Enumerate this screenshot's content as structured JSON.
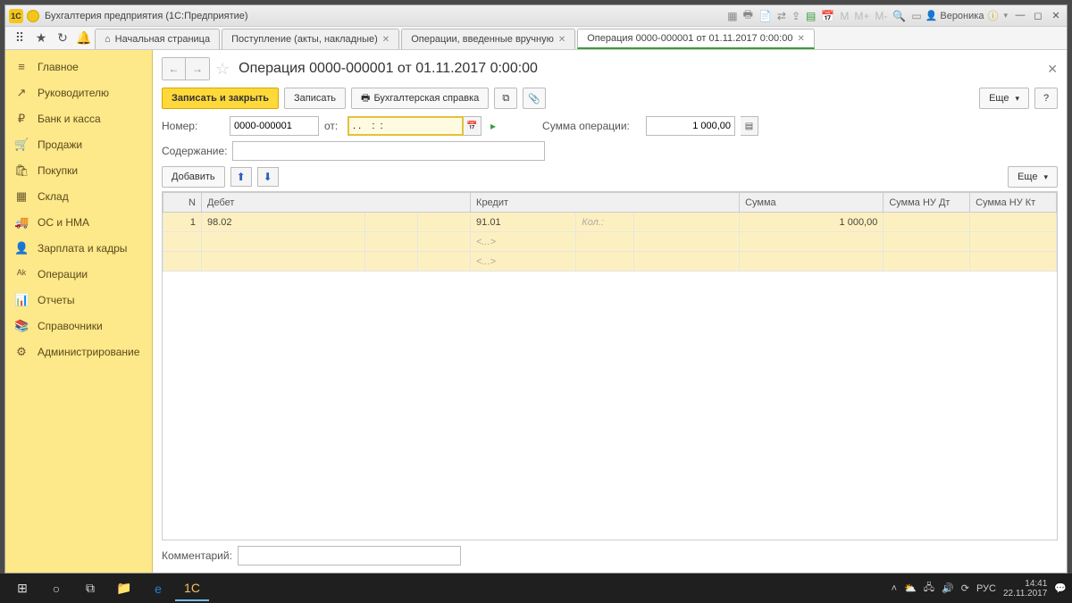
{
  "titlebar": {
    "app_badge": "1C",
    "title": "Бухгалтерия предприятия  (1С:Предприятие)",
    "user": "Вероника"
  },
  "tabs": {
    "home": "Начальная страница",
    "t1": "Поступление (акты, накладные)",
    "t2": "Операции, введенные вручную",
    "t3": "Операция 0000-000001 от 01.11.2017 0:00:00"
  },
  "sidebar": [
    {
      "icon": "≡",
      "label": "Главное"
    },
    {
      "icon": "↗",
      "label": "Руководителю"
    },
    {
      "icon": "₽",
      "label": "Банк и касса"
    },
    {
      "icon": "🛒",
      "label": "Продажи"
    },
    {
      "icon": "🛍",
      "label": "Покупки"
    },
    {
      "icon": "▦",
      "label": "Склад"
    },
    {
      "icon": "🚚",
      "label": "ОС и НМА"
    },
    {
      "icon": "👤",
      "label": "Зарплата и кадры"
    },
    {
      "icon": "ᴬᵏ",
      "label": "Операции"
    },
    {
      "icon": "📊",
      "label": "Отчеты"
    },
    {
      "icon": "📚",
      "label": "Справочники"
    },
    {
      "icon": "⚙",
      "label": "Администрирование"
    }
  ],
  "page": {
    "title": "Операция 0000-000001 от 01.11.2017 0:00:00",
    "save_close": "Записать и закрыть",
    "save": "Записать",
    "report": "Бухгалтерская справка",
    "more": "Еще",
    "help": "?",
    "number_label": "Номер:",
    "number_value": "0000-000001",
    "date_label": "от:",
    "date_value": ". .    :  :",
    "sum_label": "Сумма операции:",
    "sum_value": "1 000,00",
    "desc_label": "Содержание:",
    "desc_value": "",
    "add": "Добавить",
    "comment_label": "Комментарий:",
    "comment_value": ""
  },
  "grid": {
    "headers": {
      "n": "N",
      "debit": "Дебет",
      "credit": "Кредит",
      "sum": "Сумма",
      "sumdt": "Сумма НУ Дт",
      "sumkt": "Сумма НУ Кт"
    },
    "row": {
      "n": "1",
      "debit": "98.02",
      "credit": "91.01",
      "qty": "Кол.:",
      "sum": "1 000,00",
      "ph": "<...>"
    }
  },
  "taskbar": {
    "time": "14:41",
    "date": "22.11.2017",
    "lang": "РУС"
  }
}
